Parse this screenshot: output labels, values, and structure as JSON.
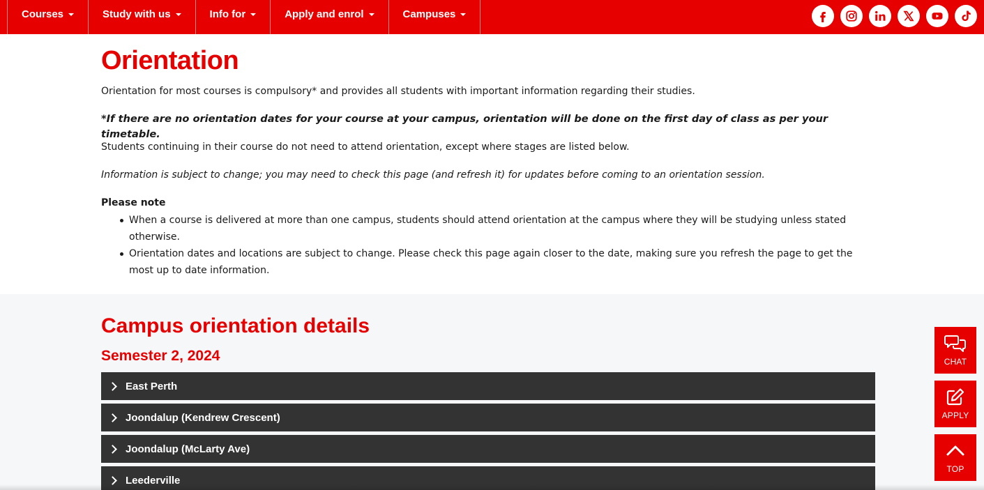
{
  "nav": {
    "items": [
      {
        "label": "Courses"
      },
      {
        "label": "Study with us"
      },
      {
        "label": "Info for"
      },
      {
        "label": "Apply and enrol"
      },
      {
        "label": "Campuses"
      }
    ],
    "socials": [
      "facebook-icon",
      "instagram-icon",
      "linkedin-icon",
      "x-icon",
      "youtube-icon",
      "tiktok-icon"
    ]
  },
  "intro": {
    "title": "Orientation",
    "p1": "Orientation for most courses is compulsory* and provides all students with important information regarding their studies.",
    "p2": "*If there are no orientation dates for your course at your campus, orientation will be done on the first day of class as per your timetable.",
    "p3": "Students continuing in their course do not need to attend orientation, except where stages are listed below.",
    "p4": "Information is subject to change; you may need to check this page (and refresh it) for updates before coming to an orientation session.",
    "note_title": "Please note",
    "notes": [
      "When a course is delivered at more than one campus, students should attend orientation at the campus where they will be studying unless stated otherwise.",
      "Orientation dates and locations are subject to change. Please check this page again closer to the date, making sure you refresh the page to get the most up to date information."
    ]
  },
  "campus": {
    "title": "Campus orientation details",
    "semester": "Semester 2, 2024",
    "items": [
      {
        "label": "East Perth"
      },
      {
        "label": "Joondalup (Kendrew Crescent)"
      },
      {
        "label": "Joondalup (McLarty Ave)"
      },
      {
        "label": "Leederville"
      }
    ]
  },
  "floating": {
    "chat": "CHAT",
    "apply": "APPLY",
    "top": "TOP"
  },
  "colors": {
    "brand_red": "#e60000",
    "accordion_bg": "#333333",
    "section_bg": "#f6f7f9"
  }
}
